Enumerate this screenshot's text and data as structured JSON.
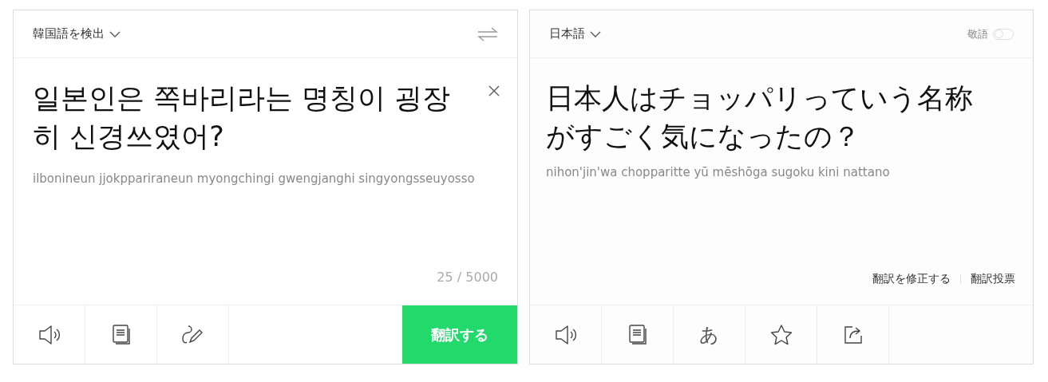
{
  "source": {
    "language": "韓国語を検出",
    "text": "일본인은 쪽바리라는 명칭이 굉장히 신경쓰였어?",
    "romanization": "ilbonineun jjokppariraneun myongchingi gwengjanghi singyongsseuyosso",
    "counter": "25 / 5000",
    "translate_button": "翻訳する"
  },
  "target": {
    "language": "日本語",
    "honorific": {
      "label": "敬語",
      "on": false
    },
    "text": "日本人はチョッパリっていう名称がすごく気になったの？",
    "romanization": "nihon'jin'wa chopparitte yū mēshōga sugoku kini nattano",
    "links": [
      "翻訳を修正する",
      "翻訳投票"
    ],
    "kana_button": "あ"
  }
}
